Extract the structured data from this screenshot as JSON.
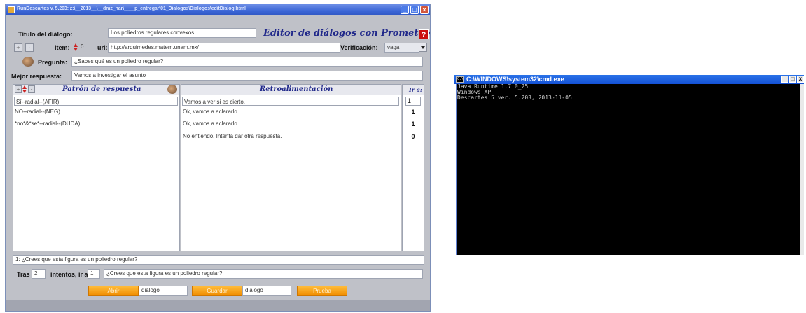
{
  "editor": {
    "window_title": "RunDescartes v. 5.203: z:\\__2013__\\__dmz_har\\____p_entregar\\01_Dialogos\\Dialogos\\editDialog.html",
    "heading": "Editor de diálogos con Prometeo",
    "titulo_label": "Título del diálogo:",
    "titulo_value": "Los poliedros regulares convexos",
    "help_label": "?",
    "item_label": "Item:",
    "item_value": "0",
    "url_label": "url:",
    "url_value": "http://arquimedes.matem.unam.mx/",
    "verificacion_label": "Verificación:",
    "verificacion_value": "vaga",
    "pregunta_label": "Pregunta:",
    "pregunta_value": "¿Sabes qué es un poliedro regular?",
    "mejor_label": "Mejor respuesta:",
    "mejor_value": "Vamos a investigar el asunto",
    "col_patron": "Patrón de respuesta",
    "col_retro": "Retroalimentación",
    "col_ir": "Ir a:",
    "rows": [
      {
        "patron": "Sí--radial--(AFIR)",
        "retro": "Vamos a ver si es cierto.",
        "ir": "1"
      },
      {
        "patron": "NO--radial--(NEG)",
        "retro": "Ok, vamos a aclararlo.",
        "ir": "1"
      },
      {
        "patron": "*no*&*se*--radial--(DUDA)",
        "retro": "Ok, vamos a aclararlo.",
        "ir": "1"
      },
      {
        "patron": "",
        "retro": "No entiendo. Intenta dar otra respuesta.",
        "ir": "0"
      }
    ],
    "next_question": "1: ¿Crees que esta figura es un poliedro regular?",
    "tras_label": "Tras",
    "tras_value": "2",
    "intentos_label": "intentos, ir a",
    "intentos_value": "1",
    "intentos_question": "¿Crees que esta figura es un poliedro regular?",
    "abrir_label": "Abrir",
    "abrir_value": "dialogo",
    "guardar_label": "Guardar",
    "guardar_value": "dialogo",
    "prueba_label": "Prueba",
    "plus_label": "+",
    "minus_label": "-"
  },
  "cmd": {
    "title": "C:\\WINDOWS\\system32\\cmd.exe",
    "lines": [
      "Java Runtime 1.7.0_25",
      "Windows XP",
      "Descartes 5 ver. 5.203, 2013-11-05"
    ],
    "icon_text": "C:\\",
    "min_label": "_",
    "max_label": "□",
    "close_label": "x"
  },
  "colors": {
    "accent_orange": "#f5a017",
    "heading_blue": "#20288a",
    "help_red": "#cc1010"
  }
}
